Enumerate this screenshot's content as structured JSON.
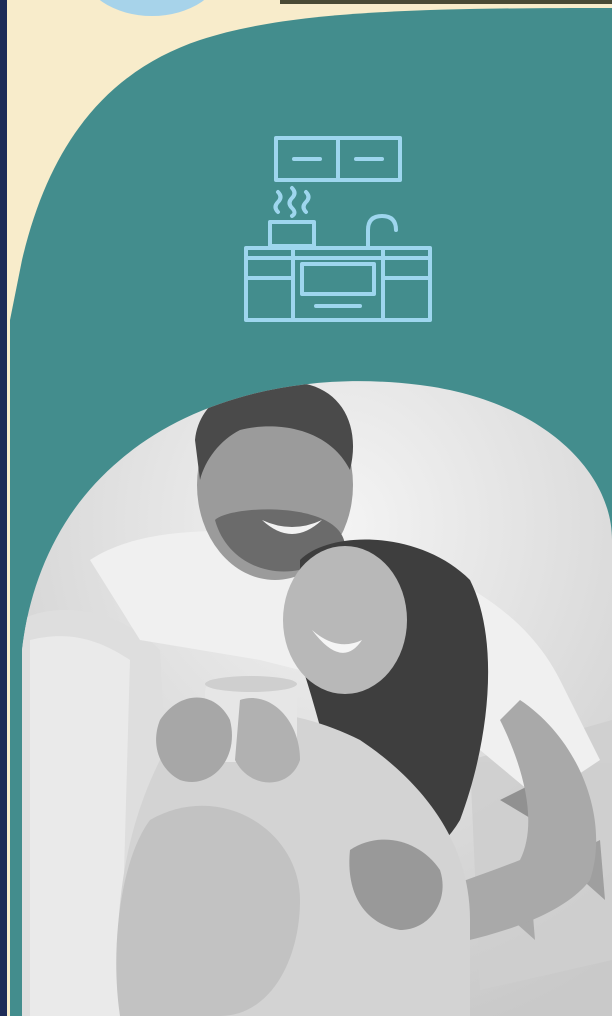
{
  "colors": {
    "teal": "#438d8d",
    "cream": "#f8eccb",
    "navy": "#1d2b57",
    "light_blue": "#a7d3ea",
    "icon_stroke": "#9ed6ee"
  },
  "icon": {
    "name": "kitchen-icon"
  },
  "photo": {
    "subject": "couple-photo"
  }
}
